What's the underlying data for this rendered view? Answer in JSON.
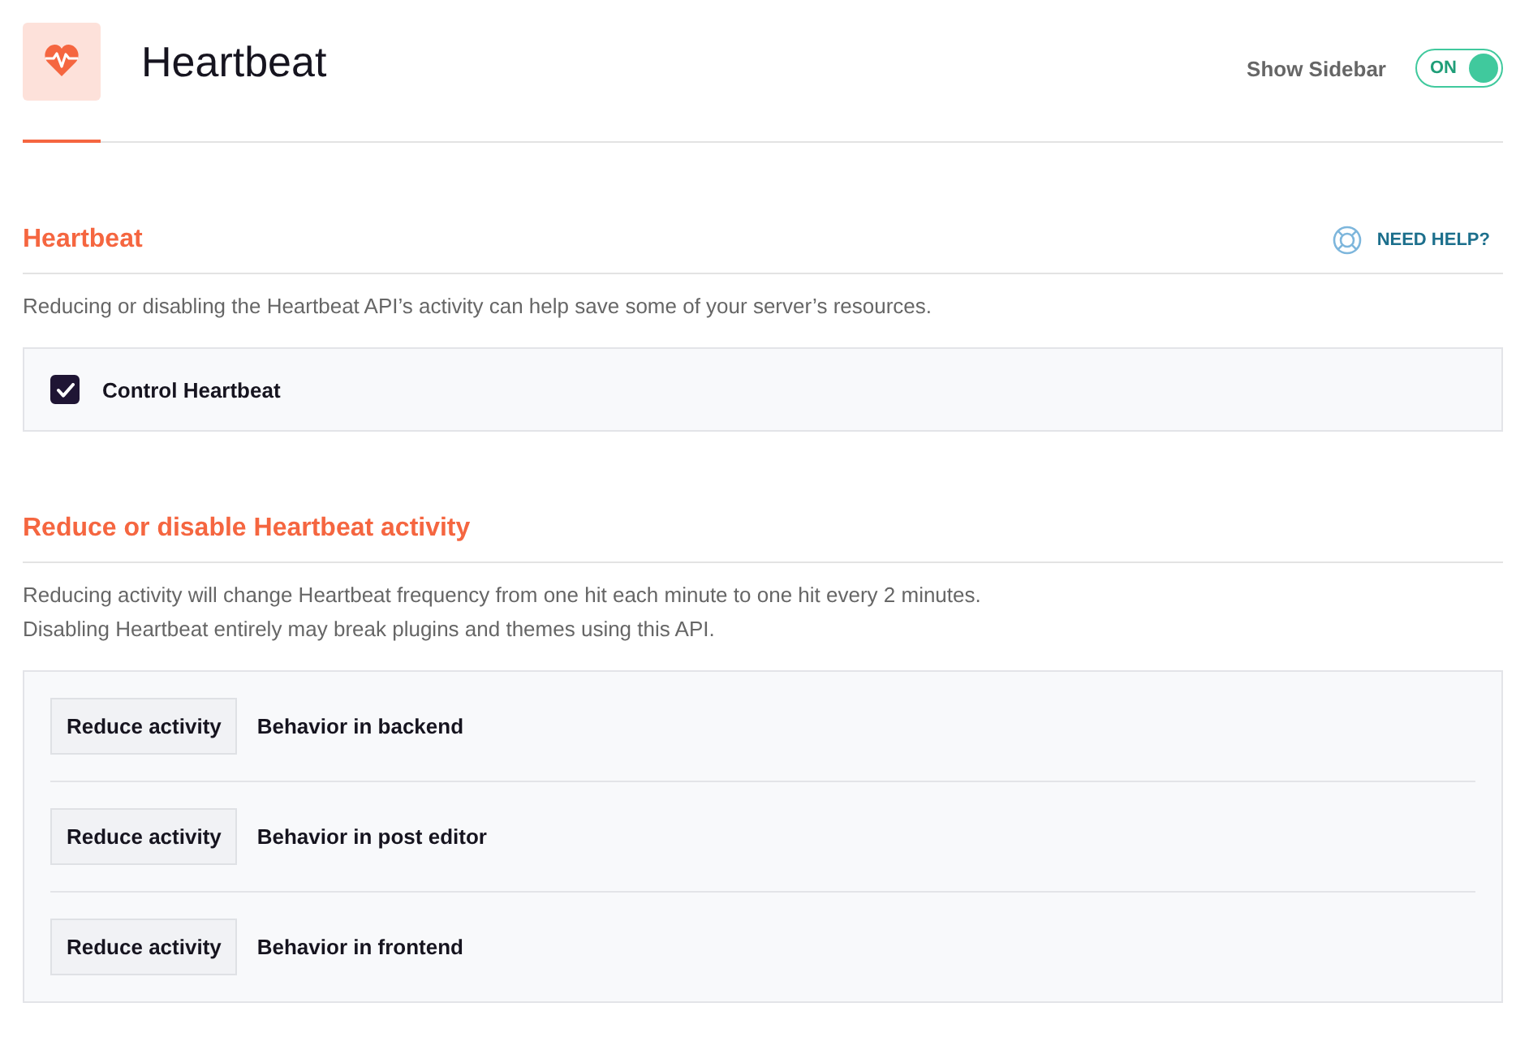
{
  "header": {
    "title": "Heartbeat",
    "sidebar_toggle": {
      "label": "Show Sidebar",
      "state_text": "ON",
      "on": true
    }
  },
  "sections": [
    {
      "title": "Heartbeat",
      "help_link": "NEED HELP?",
      "description": [
        "Reducing or disabling the Heartbeat API’s activity can help save some of your server’s resources."
      ],
      "options": [
        {
          "kind": "checkbox",
          "label": "Control Heartbeat",
          "checked": true
        }
      ]
    },
    {
      "title": "Reduce or disable Heartbeat activity",
      "description": [
        "Reducing activity will change Heartbeat frequency from one hit each minute to one hit every 2 minutes.",
        "Disabling Heartbeat entirely may break plugins and themes using this API."
      ],
      "options": [
        {
          "kind": "select",
          "value": "Reduce activity",
          "label": "Behavior in backend"
        },
        {
          "kind": "select",
          "value": "Reduce activity",
          "label": "Behavior in post editor"
        },
        {
          "kind": "select",
          "value": "Reduce activity",
          "label": "Behavior in frontend"
        }
      ]
    }
  ]
}
